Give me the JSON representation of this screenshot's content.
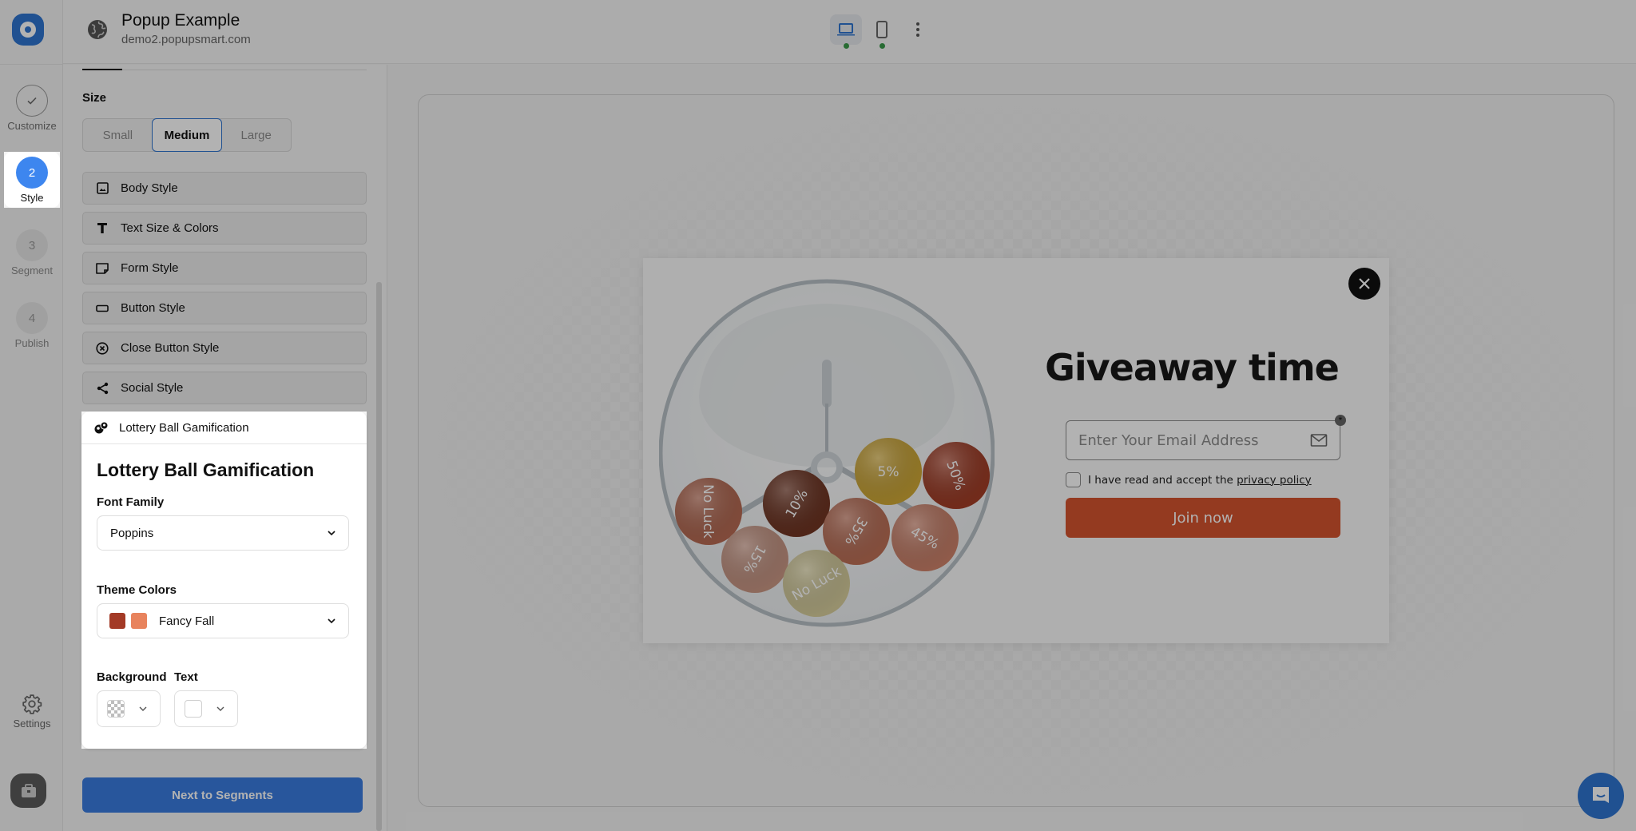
{
  "app": {
    "title": "Popup Example",
    "domain": "demo2.popupsmart.com",
    "logo_icon": "popupsmart-logo"
  },
  "steps": [
    {
      "number": "✓",
      "label": "Customize",
      "state": "done"
    },
    {
      "number": "2",
      "label": "Style",
      "state": "active"
    },
    {
      "number": "3",
      "label": "Segment",
      "state": "todo"
    },
    {
      "number": "4",
      "label": "Publish",
      "state": "todo"
    }
  ],
  "rail_bottom": {
    "settings_label": "Settings",
    "settings_icon": "gear-icon",
    "toolbox_icon": "briefcase-icon"
  },
  "devices": [
    {
      "name": "desktop",
      "icon": "laptop-icon",
      "active": true,
      "status_color": "#3a9a49"
    },
    {
      "name": "mobile",
      "icon": "phone-icon",
      "active": false,
      "status_color": "#3a9a49"
    }
  ],
  "panel": {
    "size": {
      "label": "Size",
      "options": [
        "Small",
        "Medium",
        "Large"
      ],
      "selected": "Medium"
    },
    "sections": [
      {
        "label": "Body Style",
        "icon": "image-icon"
      },
      {
        "label": "Text Size & Colors",
        "icon": "text-icon"
      },
      {
        "label": "Form Style",
        "icon": "form-icon"
      },
      {
        "label": "Button Style",
        "icon": "button-icon"
      },
      {
        "label": "Close Button Style",
        "icon": "close-circle-icon"
      },
      {
        "label": "Social Style",
        "icon": "share-icon"
      }
    ],
    "gamification": {
      "header": "Lottery Ball Gamification",
      "title": "Lottery Ball Gamification",
      "font_family_label": "Font Family",
      "font_family_value": "Poppins",
      "theme_colors_label": "Theme Colors",
      "theme_colors_value": "Fancy Fall",
      "theme_swatches": [
        "#a33a26",
        "#e8835d"
      ],
      "background_label": "Background",
      "background_value": "transparent",
      "text_label": "Text",
      "text_value": "#ffffff"
    },
    "next_button": "Next to Segments"
  },
  "popup": {
    "headline": "Giveaway time",
    "email_placeholder": "Enter Your Email Address",
    "consent_prefix": "I have read and accept the ",
    "consent_link": "privacy policy",
    "submit": "Join now",
    "submit_color": "#d5532f",
    "balls": [
      {
        "label": "No Luck",
        "color": "#c8745a"
      },
      {
        "label": "10%",
        "color": "#7b3a26"
      },
      {
        "label": "5%",
        "color": "#e2b73b"
      },
      {
        "label": "50%",
        "color": "#b2432a"
      },
      {
        "label": "15%",
        "color": "#dca591"
      },
      {
        "label": "35%",
        "color": "#cf7a5f"
      },
      {
        "label": "45%",
        "color": "#e08e74"
      },
      {
        "label": "No Luck",
        "color": "#ebe1ab"
      }
    ]
  }
}
